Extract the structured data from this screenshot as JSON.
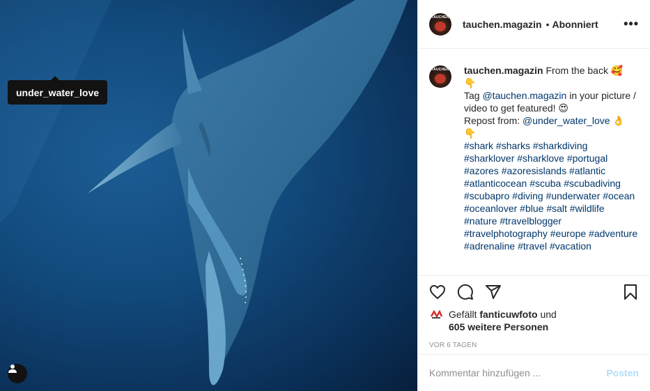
{
  "media": {
    "tag_label": "under_water_love"
  },
  "header": {
    "username": "tauchen.magazin",
    "separator": "•",
    "follow_status": "Abonniert",
    "more_label": "•••"
  },
  "caption": {
    "username": "tauchen.magazin",
    "line1": "From the back 🥰",
    "line2": "👇",
    "tag_prefix": "Tag ",
    "tag_mention": "@tauchen.magazin",
    "tag_suffix": " in your picture / video to get featured! 😍",
    "repost_prefix": "Repost from: ",
    "repost_mention": "@under_water_love",
    "repost_suffix": " 👌",
    "line_after": "👇",
    "hashtags": [
      "#shark",
      "#sharks",
      "#sharkdiving",
      "#sharklover",
      "#sharklove",
      "#portugal",
      "#azores",
      "#azoresislands",
      "#atlantic",
      "#atlanticocean",
      "#scuba",
      "#scubadiving",
      "#scubapro",
      "#diving",
      "#underwater",
      "#ocean",
      "#oceanlover",
      "#blue",
      "#salt",
      "#wildlife",
      "#nature",
      "#travelblogger",
      "#travelphotography",
      "#europe",
      "#adventure",
      "#adrenaline",
      "#travel",
      "#vacation"
    ]
  },
  "likes": {
    "prefix": "Gefällt ",
    "user": "fanticuwfoto",
    "middle": " und",
    "others": "605 weitere Personen"
  },
  "timestamp": "VOR 6 TAGEN",
  "comment": {
    "placeholder": "Kommentar hinzufügen ...",
    "post_label": "Posten"
  },
  "colors": {
    "link": "#00376b",
    "post_disabled": "#b2dffc",
    "meta_gray": "#8e8e8e"
  }
}
